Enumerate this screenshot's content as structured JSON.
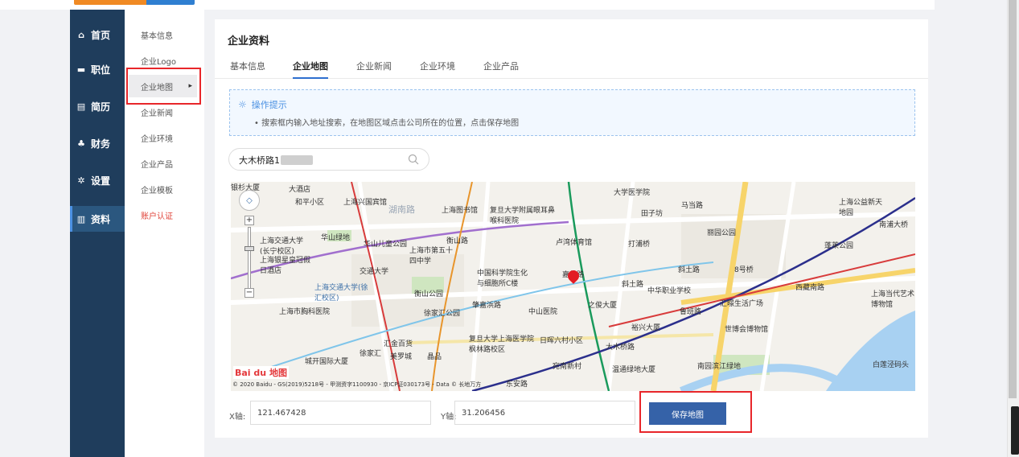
{
  "sidebar": {
    "items": [
      {
        "label": "首页",
        "icon": "home-icon",
        "glyph": "⌂"
      },
      {
        "label": "职位",
        "icon": "briefcase-icon",
        "glyph": "▬"
      },
      {
        "label": "简历",
        "icon": "resume-icon",
        "glyph": "▤"
      },
      {
        "label": "财务",
        "icon": "finance-icon",
        "glyph": "♣"
      },
      {
        "label": "设置",
        "icon": "gear-icon",
        "glyph": "✲"
      },
      {
        "label": "资料",
        "icon": "profile-icon",
        "glyph": "▥"
      }
    ],
    "active_color": "#2b577f"
  },
  "submenu": {
    "items": [
      "基本信息",
      "企业Logo",
      "企业地图",
      "企业新闻",
      "企业环境",
      "企业产品",
      "企业模板",
      "账户认证"
    ]
  },
  "card": {
    "title": "企业资料",
    "tabs": [
      "基本信息",
      "企业地图",
      "企业新闻",
      "企业环境",
      "企业产品"
    ]
  },
  "tip": {
    "title": "操作提示",
    "text": "• 搜索框内输入地址搜索，在地图区域点击公司所在的位置，点击保存地图"
  },
  "search": {
    "value": "大木桥路1"
  },
  "map": {
    "labels": [
      "银杉大厦",
      "大酒店",
      "和平小区",
      "上海兴国宾馆",
      "湖南路",
      "上海图书馆",
      "复旦大学附属眼耳鼻喉科医院",
      "大学医学院",
      "马当路",
      "上海公益新天地园",
      "南浦大桥",
      "田子坊",
      "丽园公园",
      "蓬莱公园",
      "华山绿地",
      "上海交通大学(长宁校区)",
      "华山儿童公园",
      "衡山路",
      "上海市第五十四中学",
      "卢湾体育馆",
      "打浦桥",
      "上海银星皇冠假日酒店",
      "交通大学",
      "上海交通大学(徐汇校区)",
      "中国科学院生化与细胞所C楼",
      "嘉善路",
      "斜土路",
      "8号桥",
      "西藏南路",
      "衡山公园",
      "中华职业学校",
      "上海当代艺术博物馆",
      "上海市胸科医院",
      "徐家汇公园",
      "肇嘉浜路",
      "中山医院",
      "之俊大厦",
      "鲁班路",
      "汇暻生活广场",
      "裕兴大厦",
      "世博会博物馆",
      "汇金百货",
      "复旦大学上海医学院枫林路校区",
      "日晖六村小区",
      "大木桥路",
      "徐家汇",
      "城开国际大厦",
      "美罗城",
      "晶品",
      "斜土路",
      "宛南新村",
      "温通绿地大厦",
      "南园滨江绿地",
      "白莲泾码头",
      "东安路"
    ],
    "copyright": "© 2020 Baidu - GS(2019)5218号 - 甲测资字1100930 - 京ICP证030173号 - Data © 长地万方",
    "logo": "Bai du 地图",
    "pan_glyph": "◇",
    "zoom_in": "+",
    "zoom_out": "−"
  },
  "coords": {
    "x_label": "X轴:",
    "x_value": "121.467428",
    "y_label": "Y轴:",
    "y_value": "31.206456"
  },
  "save_button": "保存地图",
  "colors": {
    "sidebar_bg": "#1f3d5c",
    "accent": "#2e6fcf",
    "button": "#3562a8",
    "highlight": "#e8262a"
  }
}
